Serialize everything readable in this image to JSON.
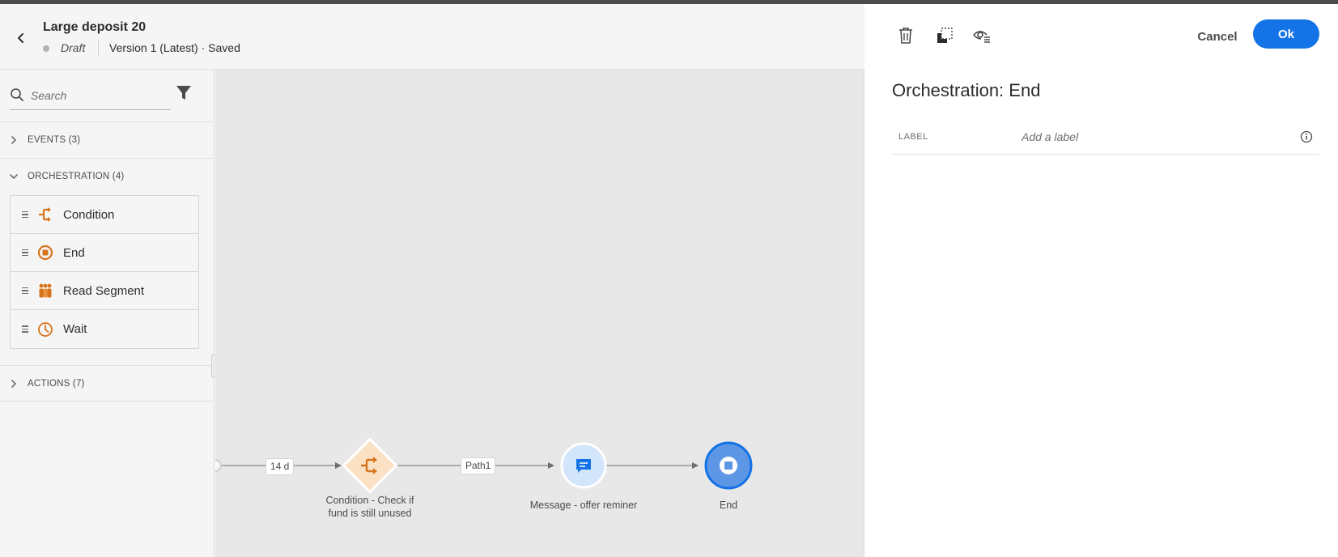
{
  "header": {
    "title": "Large deposit 20",
    "status": "Draft",
    "version": "Version 1 (Latest) · Saved"
  },
  "palette": {
    "search_placeholder": "Search",
    "sections": {
      "events": "EVENTS (3)",
      "orchestration": "ORCHESTRATION (4)",
      "actions": "ACTIONS (7)"
    },
    "orchestration_items": [
      {
        "label": "Condition",
        "icon": "condition-icon"
      },
      {
        "label": "End",
        "icon": "end-icon"
      },
      {
        "label": "Read Segment",
        "icon": "read-segment-icon"
      },
      {
        "label": "Wait",
        "icon": "wait-icon"
      }
    ]
  },
  "canvas": {
    "edges": {
      "wait_duration": "14 d",
      "path1": "Path1"
    },
    "nodes": {
      "condition": "Condition - Check if fund is still unused",
      "message": "Message - offer reminer",
      "end": "End"
    }
  },
  "properties": {
    "cancel_label": "Cancel",
    "ok_label": "Ok",
    "title": "Orchestration: End",
    "label_field_name": "LABEL",
    "label_placeholder": "Add a label"
  },
  "colors": {
    "accent": "#1473e6",
    "orchestration_icon": "#d6741c",
    "end_node": "#5e96e6",
    "message_node": "#d3e5fb"
  }
}
